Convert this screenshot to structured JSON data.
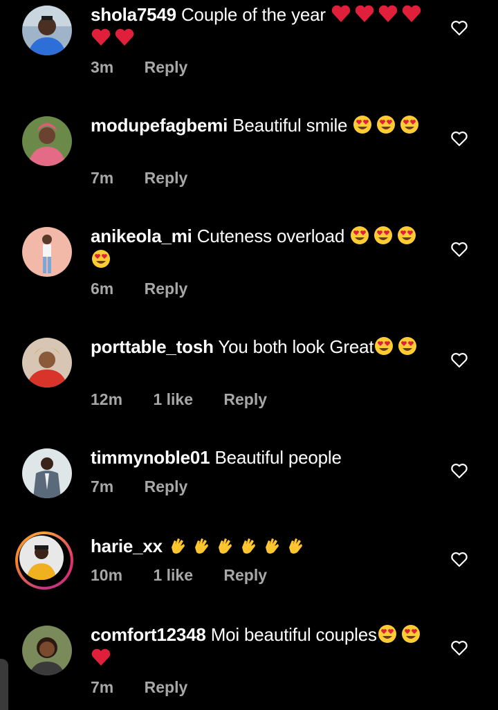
{
  "comments": [
    {
      "username": "shola7549",
      "text": "Couple of the year",
      "emojis": [
        "red-heart",
        "red-heart",
        "red-heart",
        "red-heart",
        "red-heart",
        "red-heart"
      ],
      "time": "3m",
      "likes": "",
      "reply": "Reply",
      "avatar": "avatar-man-blue-shirt"
    },
    {
      "username": "modupefagbemi",
      "text": "Beautiful smile",
      "emojis": [
        "heart-eyes",
        "heart-eyes",
        "heart-eyes"
      ],
      "time": "7m",
      "likes": "",
      "reply": "Reply",
      "avatar": "avatar-woman-pink"
    },
    {
      "username": "anikeola_mi",
      "text": "Cuteness overload",
      "emojis": [
        "heart-eyes",
        "heart-eyes",
        "heart-eyes",
        "heart-eyes"
      ],
      "time": "6m",
      "likes": "",
      "reply": "Reply",
      "avatar": "avatar-person-pink-bg"
    },
    {
      "username": "porttable_tosh",
      "text": "You both look Great",
      "emojis": [
        "heart-eyes",
        "heart-eyes"
      ],
      "time": "12m",
      "likes": "1 like",
      "reply": "Reply",
      "avatar": "avatar-woman-red-gele"
    },
    {
      "username": "timmynoble01",
      "text": "Beautiful people",
      "emojis": [],
      "time": "7m",
      "likes": "",
      "reply": "Reply",
      "avatar": "avatar-man-suit"
    },
    {
      "username": "harie_xx",
      "text": "",
      "emojis": [
        "clapping-hands",
        "clapping-hands",
        "clapping-hands",
        "clapping-hands",
        "clapping-hands",
        "clapping-hands"
      ],
      "time": "10m",
      "likes": "1 like",
      "reply": "Reply",
      "avatar": "avatar-woman-yellow"
    },
    {
      "username": "comfort12348",
      "text": "Moi beautiful couples",
      "emojis": [
        "heart-eyes",
        "heart-eyes",
        "red-heart"
      ],
      "time": "7m",
      "likes": "",
      "reply": "Reply",
      "avatar": "avatar-woman-smiling"
    }
  ],
  "colors": {
    "background": "#000000",
    "meta_text": "#a8a8a8",
    "heart_emoji": "#e0203a",
    "face_emoji": "#ffcc33"
  }
}
